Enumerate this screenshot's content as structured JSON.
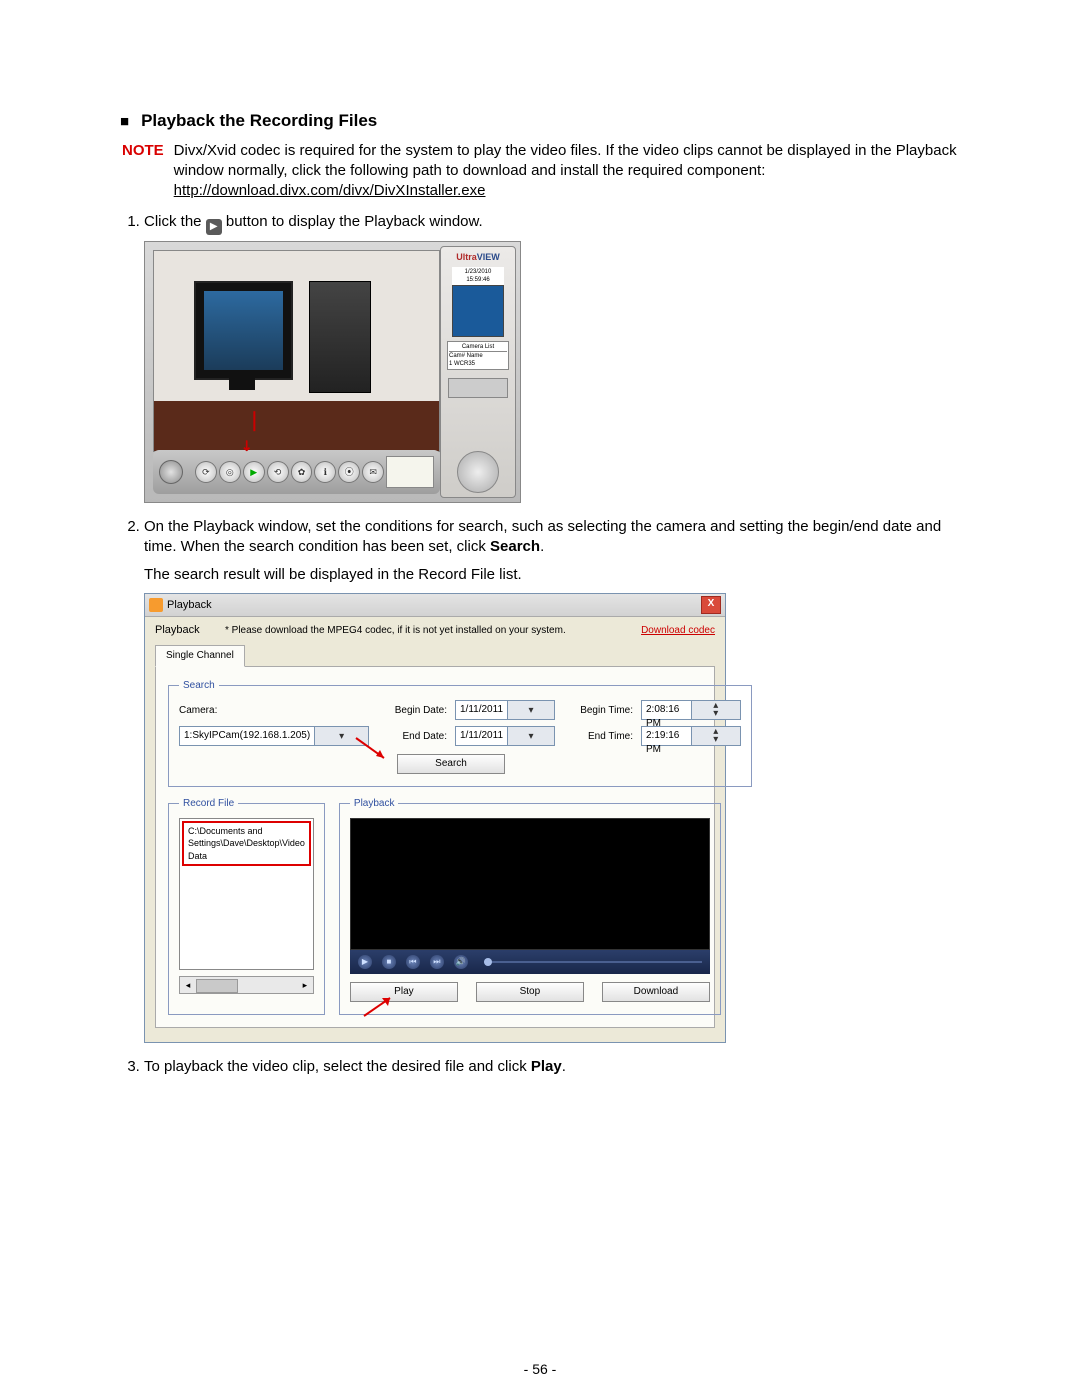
{
  "heading_bullet": "■",
  "heading": "Playback the Recording Files",
  "note_label": "NOTE",
  "note_body_pre": "Divx/Xvid codec is required for the system to play the video files. If the video clips cannot be displayed in the Playback window normally, click the following path to download and install the required component: ",
  "note_link": "http://download.divx.com/divx/DivXInstaller.exe",
  "step1_pre": "Click the ",
  "step1_post": " button to display the Playback window.",
  "step2_text": "On the Playback window, set the conditions for search, such as selecting the camera and setting the begin/end date and time. When the search condition has been set, click ",
  "step2_bold": "Search",
  "step2_after": "The search result will be displayed in the Record File list.",
  "step3_pre": "To playback the video clip, select the desired file and click ",
  "step3_bold": "Play",
  "page_number": "- 56 -",
  "uv": {
    "logo_a": "Ultra",
    "logo_b": "VIEW",
    "preview_date": "1/23/2010\n15:59:46",
    "camlist_title": "Camera List",
    "camlist_rows": "Cam#   Name\n1      WCR35"
  },
  "dlg": {
    "title": "Playback",
    "upper_label": "Playback",
    "msg": "* Please download the MPEG4 codec, if it is not yet installed on your system.",
    "download_link": "Download codec",
    "tab": "Single Channel",
    "search": {
      "legend": "Search",
      "camera_lbl": "Camera:",
      "begin_date_lbl": "Begin Date:",
      "begin_time_lbl": "Begin Time:",
      "end_date_lbl": "End Date:",
      "end_time_lbl": "End Time:",
      "camera_val": "1:SkyIPCam(192.168.1.205)",
      "begin_date_val": "1/11/2011",
      "end_date_val": "1/11/2011",
      "begin_time_val": "2:08:16 PM",
      "end_time_val": "2:19:16 PM",
      "search_btn": "Search"
    },
    "recordfile": {
      "legend": "Record File",
      "item": "C:\\Documents and Settings\\Dave\\Desktop\\Video Data"
    },
    "pb": {
      "legend": "Playback",
      "play_btn": "Play",
      "stop_btn": "Stop",
      "download_btn": "Download"
    }
  }
}
